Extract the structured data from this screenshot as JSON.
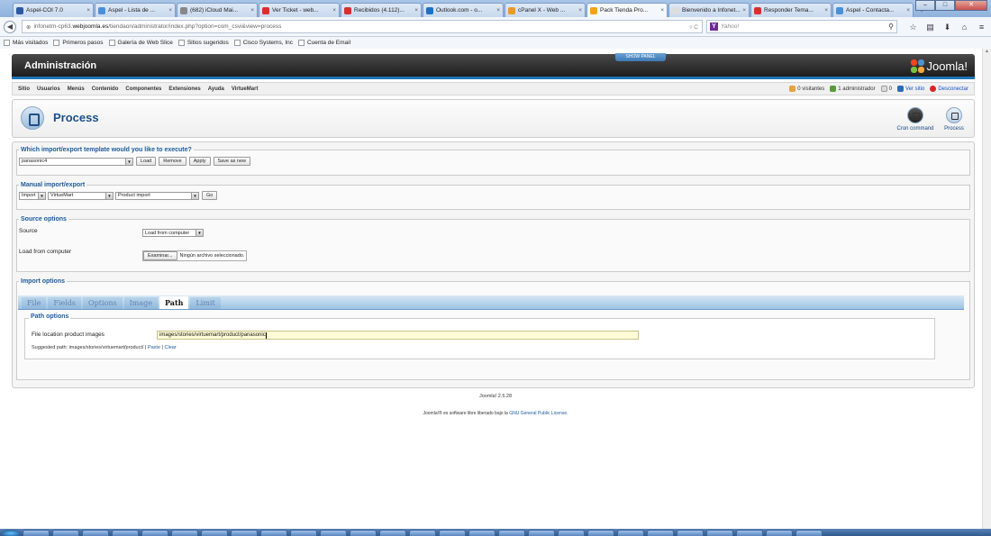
{
  "browser": {
    "tabs": [
      {
        "label": "Aspel-COI 7.0",
        "color": "#2c5aa0",
        "active": false
      },
      {
        "label": "Aspel - Lista de ...",
        "color": "#4a90d9",
        "active": false
      },
      {
        "label": "(682) iCloud Mai...",
        "color": "#888888",
        "active": false
      },
      {
        "label": "Ver Ticket - web...",
        "color": "#d9302e",
        "active": false
      },
      {
        "label": "Recibidos (4.112)...",
        "color": "#d9302e",
        "active": false
      },
      {
        "label": "Outlook.com - o...",
        "color": "#1d6fc8",
        "active": false
      },
      {
        "label": "cPanel X - Web ...",
        "color": "#e89a2c",
        "active": false
      },
      {
        "label": "Pack Tienda Pro...",
        "color": "#f4a21c",
        "active": true
      },
      {
        "label": "Bienvenido a Infonet...",
        "color": "#dddddd",
        "active": false
      },
      {
        "label": "Responder Tema...",
        "color": "#d9302e",
        "active": false
      },
      {
        "label": "Aspel - Contacta...",
        "color": "#4a90d9",
        "active": false
      }
    ],
    "new_tab": "+",
    "url_prefix": "infonetm-cp63.",
    "url_domain": "webjoomla.es",
    "url_path": "/tiendaon/administrator/index.php?option=com_csvi&view=process",
    "search_placeholder": "Yahoo!",
    "bookmarks": [
      "Más visitados",
      "Primeros pasos",
      "Galería de Web Slice",
      "Sitios sugeridos",
      "Cisco Systems, Inc",
      "Cuenta de Email"
    ]
  },
  "joomla": {
    "header_title": "Administración",
    "show_panel": "SHOW PANEL",
    "logo_text": "Joomla!",
    "menu": [
      "Sitio",
      "Usuarios",
      "Menús",
      "Contenido",
      "Componentes",
      "Extensiones",
      "Ayuda",
      "VirtueMart"
    ],
    "status": {
      "visitors": "0 visitantes",
      "admins": "1 administrador",
      "messages": "0",
      "view_site": "Ver sitio",
      "logout": "Desconectar"
    },
    "page_title": "Process",
    "toolbar": {
      "cron": "Cron command",
      "process": "Process"
    }
  },
  "template": {
    "legend": "Which import/export template would you like to execute?",
    "selected": "panasonic4",
    "buttons": [
      "Load",
      "Remove",
      "Apply",
      "Save as new"
    ]
  },
  "manual": {
    "legend": "Manual import/export",
    "action": "Import",
    "component": "VirtueMart",
    "operation": "Product import",
    "go": "Go"
  },
  "source": {
    "legend": "Source options",
    "source_label": "Source",
    "source_value": "Load from computer",
    "file_label": "Load from computer",
    "browse": "Examinar...",
    "no_file": "Ningún archivo seleccionado."
  },
  "import": {
    "legend": "Import options",
    "tabs": [
      "File",
      "Fields",
      "Options",
      "Image",
      "Path",
      "Limit"
    ],
    "active_tab": "Path",
    "path_legend": "Path options",
    "path_label": "File location product images",
    "path_value": "images/stories/virtuemart/product/panasonic",
    "suggested_prefix": "Suggested path: images/stories/virtuemart/product/",
    "paste": "Paste",
    "clear": "Clear"
  },
  "footer": {
    "version": "Joomla! 2.5.28",
    "license_prefix": "Joomla!® es software libre liberado bajo la",
    "license_link": "GNU General Public License."
  }
}
